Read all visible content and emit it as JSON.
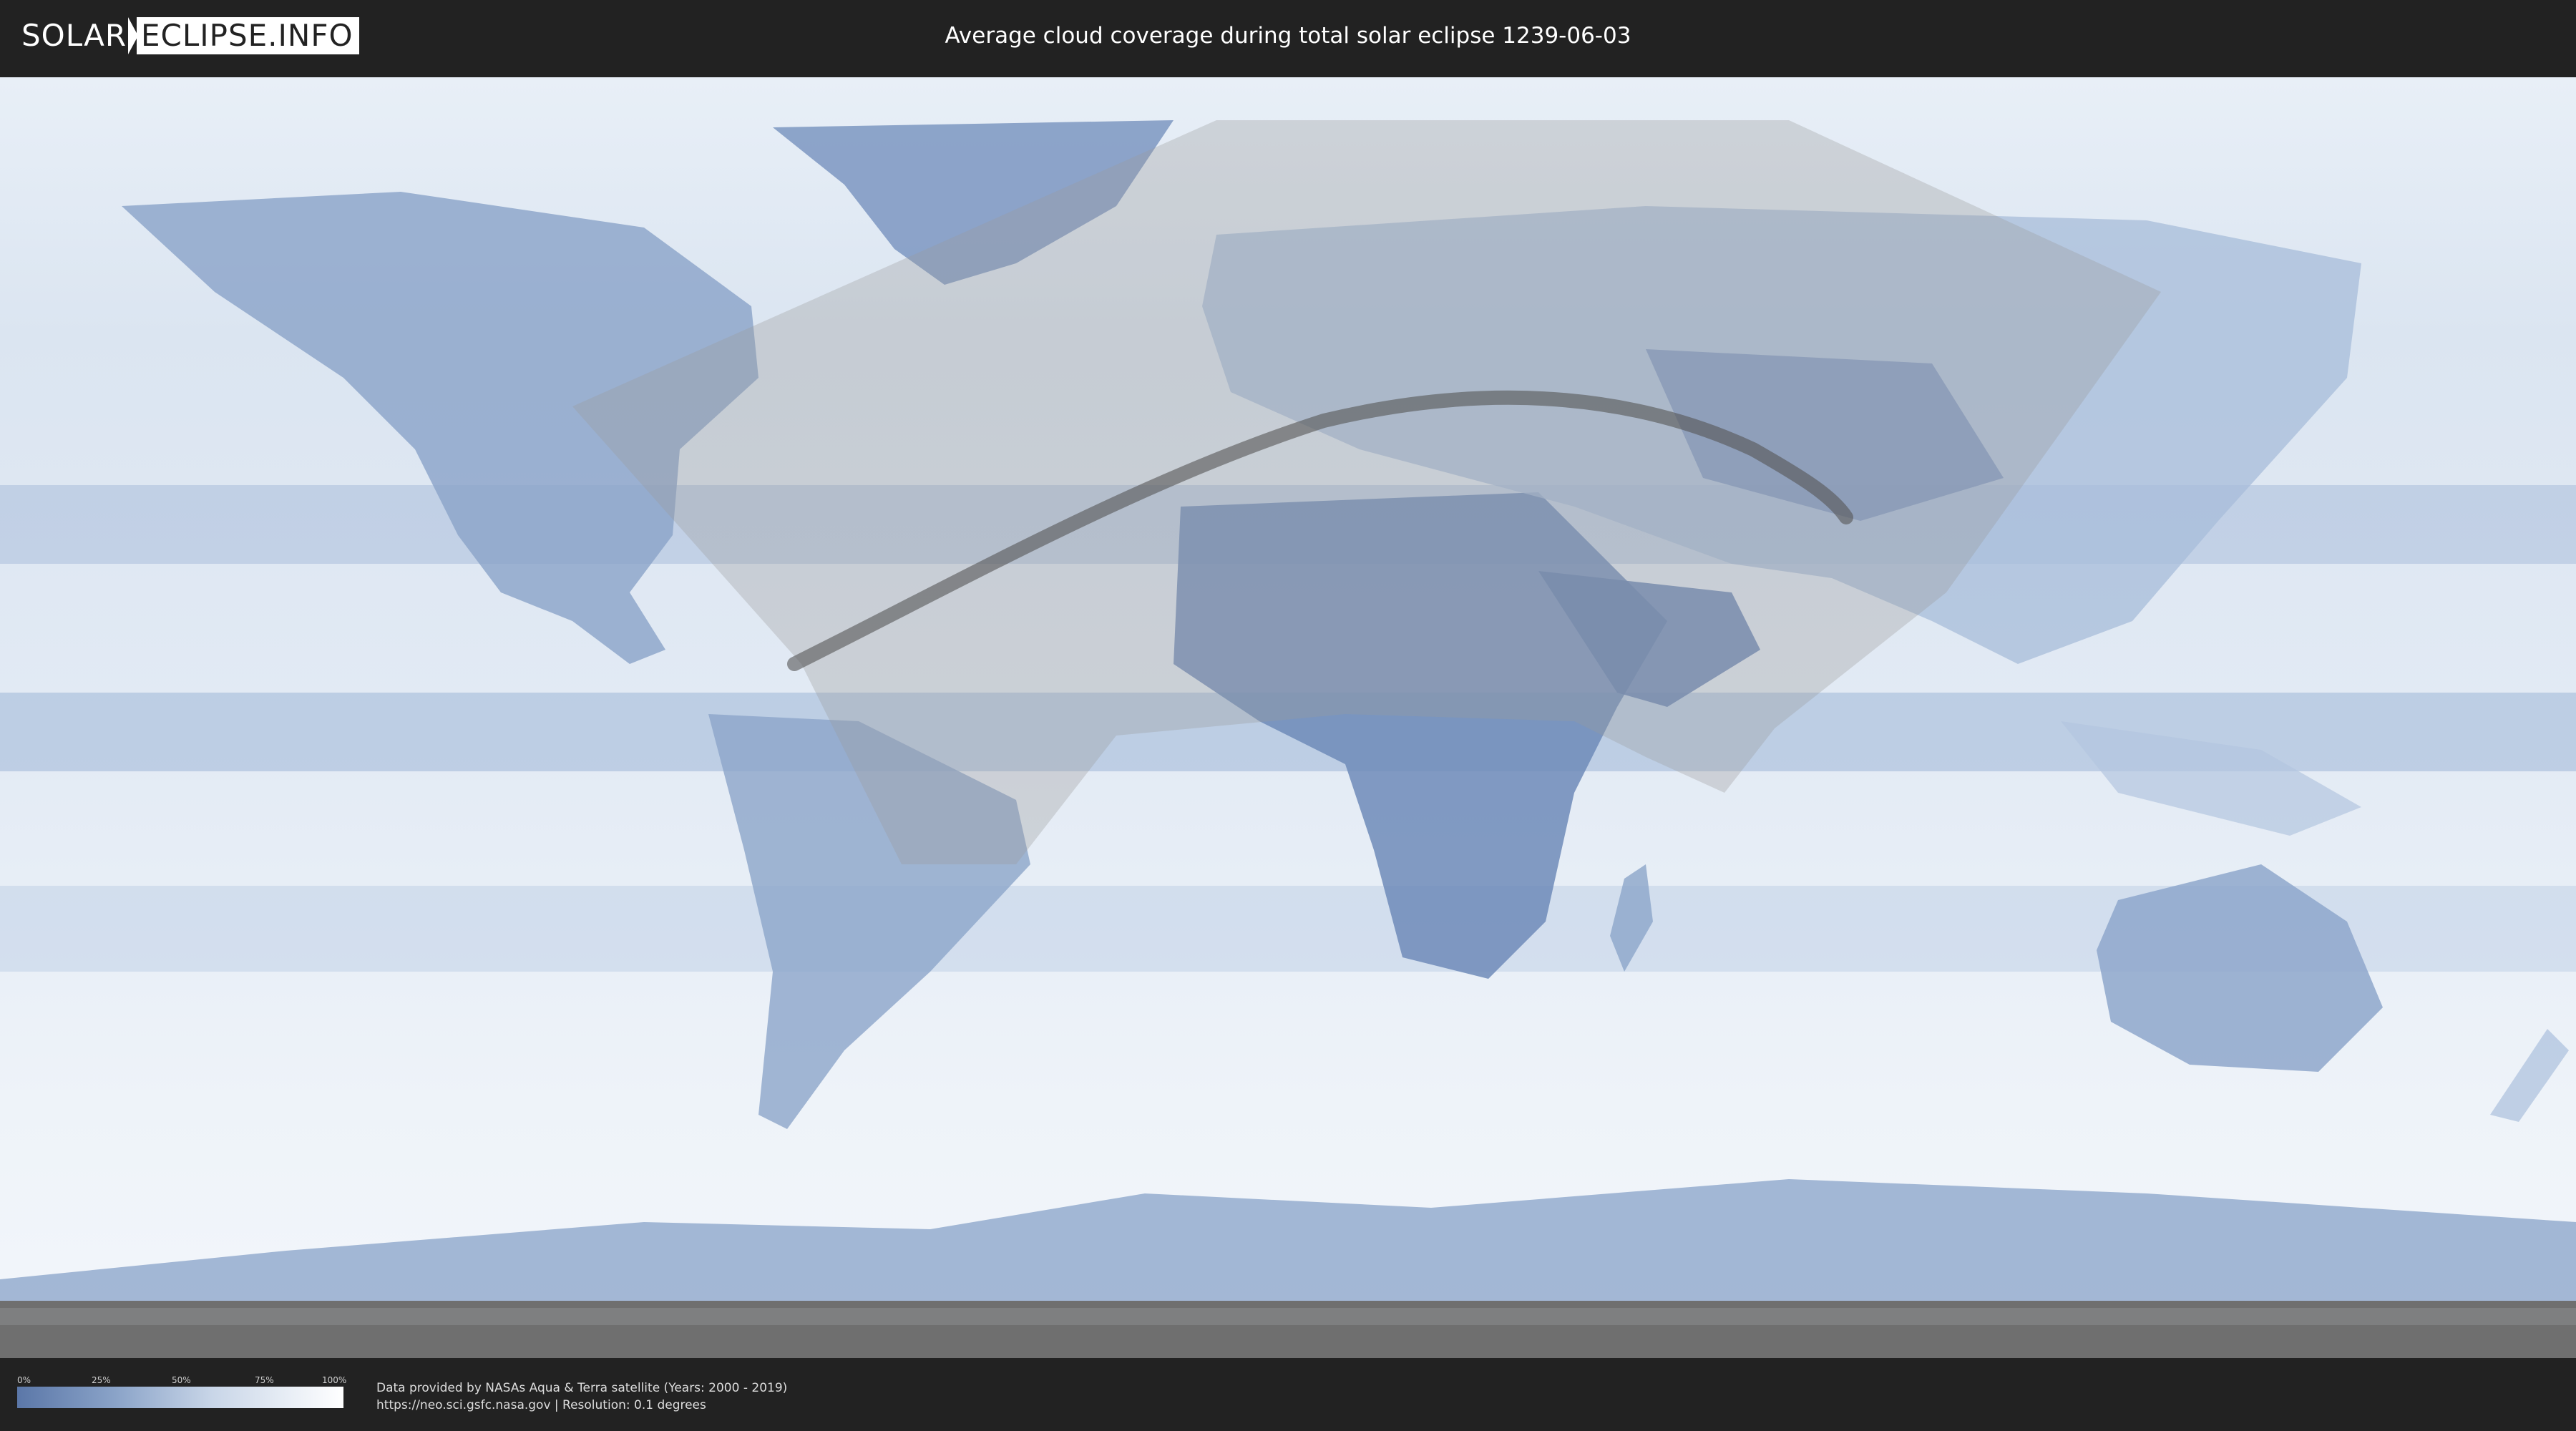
{
  "header": {
    "logo_solar": "SOLAR",
    "logo_eclipse": "ECLIPSE.INFO",
    "title": "Average cloud coverage during total solar eclipse 1239-06-03"
  },
  "legend": {
    "ticks": [
      "0%",
      "25%",
      "50%",
      "75%",
      "100%"
    ]
  },
  "footer": {
    "credit_line1": "Data provided by NASAs Aqua & Terra satellite (Years: 2000 - 2019)",
    "credit_line2": "https://neo.sci.gsfc.nasa.gov | Resolution: 0.1 degrees"
  },
  "colors": {
    "background": "#222222",
    "cloud_dark": "#5b77a8",
    "cloud_light": "#ffffff",
    "eclipse_path": "#555555"
  }
}
